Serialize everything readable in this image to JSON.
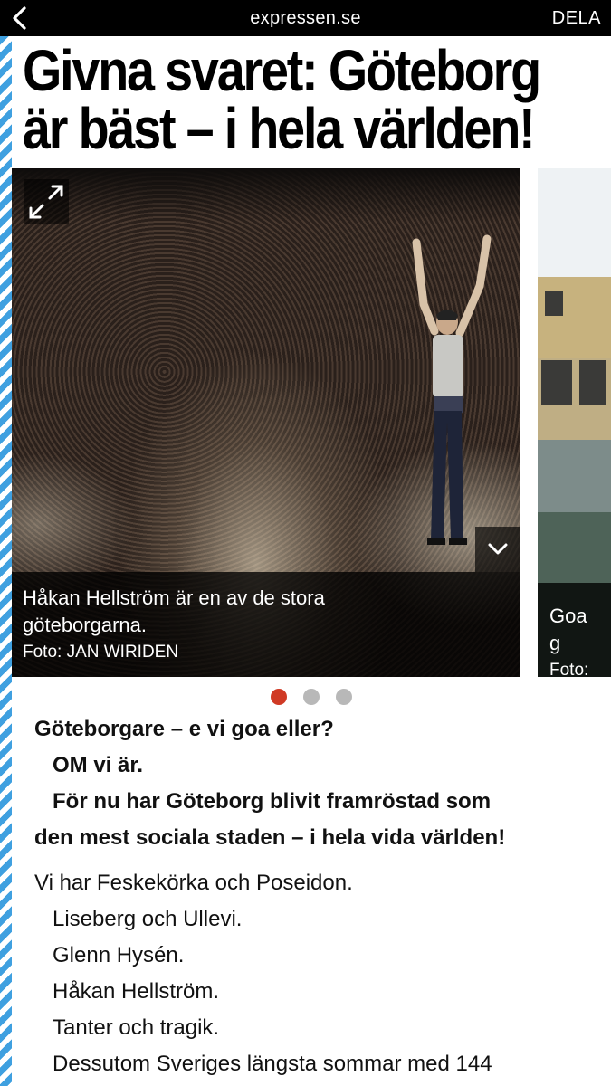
{
  "topbar": {
    "back_icon": "chevron-left-icon",
    "domain": "expressen.se",
    "share_label": "DELA"
  },
  "article": {
    "headline_line1": "Givna svaret: Göteborg",
    "headline_line2": "är bäst – i hela världen!"
  },
  "slideshow": {
    "slides": [
      {
        "caption": "Håkan Hellström är en av de stora göteborgarna.",
        "caption_line1": "Håkan Hellström är en av de stora",
        "caption_line2": "göteborgarna.",
        "credit": "Foto: JAN WIRIDEN",
        "expand_icon": "expand-arrows-icon",
        "more_icon": "chevron-down-icon"
      },
      {
        "caption_fragment": "Goa g",
        "credit_fragment": "Foto: H"
      }
    ],
    "dots": {
      "count": 3,
      "active_index": 0
    }
  },
  "body": {
    "lead": [
      "Göteborgare – e vi goa eller?",
      "OM vi är.",
      "För nu har Göteborg blivit framröstad som",
      "den mest sociala staden – i hela vida världen!"
    ],
    "paragraphs": [
      "Vi har Feskekörka och Poseidon.",
      "Liseberg och Ullevi.",
      "Glenn Hysén.",
      "Håkan Hellström.",
      "Tanter och tragik.",
      "Dessutom Sveriges längsta sommar med 144"
    ]
  },
  "colors": {
    "topbar_bg": "#000000",
    "stripe_blue": "#3fa0e0",
    "active_dot": "#d03a25",
    "inactive_dot": "#b8b8b8"
  }
}
